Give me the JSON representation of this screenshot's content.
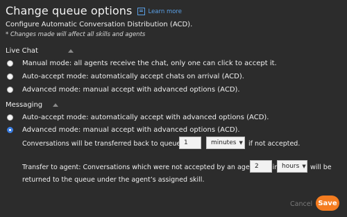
{
  "header": {
    "title": "Change queue options",
    "learn_more": "Learn more",
    "learn_icon": "book-icon"
  },
  "subtitle": "Configure Automatic Conversation Distribution (ACD).",
  "note": "* Changes made will affect all skills and agents",
  "live_chat": {
    "heading": "Live Chat",
    "collapse_icon": "caret-up-icon",
    "options": [
      {
        "label": "Manual mode: all agents receive the chat, only one can click to accept it.",
        "selected": false
      },
      {
        "label": "Auto-accept mode: automatically accept chats on arrival (ACD).",
        "selected": false
      },
      {
        "label": "Advanced mode: manual accept with advanced options (ACD).",
        "selected": false
      }
    ]
  },
  "messaging": {
    "heading": "Messaging",
    "collapse_icon": "caret-up-icon",
    "options": [
      {
        "label": "Auto-accept mode: automatically accept with advanced options (ACD).",
        "selected": false
      },
      {
        "label": "Advanced mode: manual accept with advanced options (ACD).",
        "selected": true
      }
    ],
    "transfer_back": {
      "prefix": "Conversations will be transferred back to queue after",
      "value": "1",
      "unit": "minutes",
      "suffix": "if not accepted."
    },
    "transfer_agent": {
      "prefix": "Transfer to agent: Conversations which were not accepted by an agent within",
      "value": "2",
      "unit": "hours",
      "suffix": "will be",
      "line2": "returned to the queue under the agent’s assigned skill."
    }
  },
  "footer": {
    "cancel": "Cancel",
    "save": "Save"
  },
  "colors": {
    "background": "#2c2c2c",
    "link": "#5aa0e6",
    "radio_selected": "#3b7de0",
    "save_button": "#f47c20"
  }
}
